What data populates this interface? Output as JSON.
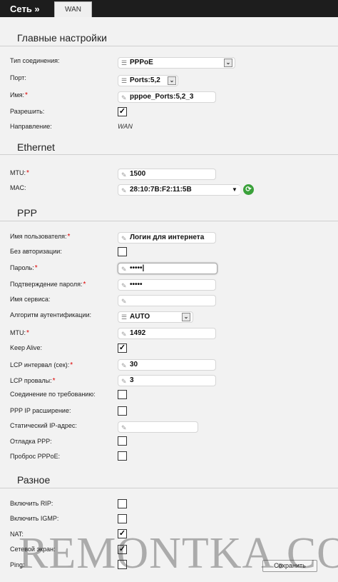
{
  "header": {
    "breadcrumb": "Сеть »",
    "tab": "WAN"
  },
  "sections": {
    "main": "Главные настройки",
    "ethernet": "Ethernet",
    "ppp": "PPP",
    "misc": "Разное"
  },
  "main": {
    "conn_type_label": "Тип соединения:",
    "conn_type_value": "PPPoE",
    "port_label": "Порт:",
    "port_value": "Ports:5,2",
    "name_label": "Имя:",
    "name_value": "pppoe_Ports:5,2_3",
    "allow_label": "Разрешить:",
    "allow_checked": true,
    "direction_label": "Направление:",
    "direction_value": "WAN"
  },
  "ethernet": {
    "mtu_label": "MTU:",
    "mtu_value": "1500",
    "mac_label": "MAC:",
    "mac_value": "28:10:7B:F2:11:5B"
  },
  "ppp": {
    "username_label": "Имя пользователя:",
    "username_value": "Логин для интернета",
    "noauth_label": "Без авторизации:",
    "noauth_checked": false,
    "password_label": "Пароль:",
    "password_value": "•••••",
    "password_confirm_label": "Подтверждение пароля:",
    "password_confirm_value": "•••••",
    "service_label": "Имя сервиса:",
    "service_value": "",
    "auth_algo_label": "Алгоритм аутентификации:",
    "auth_algo_value": "AUTO",
    "mtu_label": "MTU:",
    "mtu_value": "1492",
    "keepalive_label": "Keep Alive:",
    "keepalive_checked": true,
    "lcp_interval_label": "LCP интервал (сек):",
    "lcp_interval_value": "30",
    "lcp_fails_label": "LCP провалы:",
    "lcp_fails_value": "3",
    "on_demand_label": "Соединение по требованию:",
    "on_demand_checked": false,
    "ppp_ip_ext_label": "PPP IP расширение:",
    "ppp_ip_ext_checked": false,
    "static_ip_label": "Статический IP-адрес:",
    "static_ip_value": "",
    "debug_label": "Отладка PPP:",
    "debug_checked": false,
    "pppoe_passthrough_label": "Проброс PPPoE:",
    "pppoe_passthrough_checked": false
  },
  "misc": {
    "rip_label": "Включить RIP:",
    "rip_checked": false,
    "igmp_label": "Включить IGMP:",
    "igmp_checked": false,
    "nat_label": "NAT:",
    "nat_checked": true,
    "firewall_label": "Сетевой экран:",
    "firewall_checked": true,
    "ping_label": "Ping:",
    "ping_checked": false
  },
  "actions": {
    "save_label": "Сохранить"
  },
  "watermark": "REMONTKA.COM",
  "colors": {
    "header_bg": "#1d1d1d",
    "required": "#dd0000",
    "refresh": "#3aa13a"
  }
}
